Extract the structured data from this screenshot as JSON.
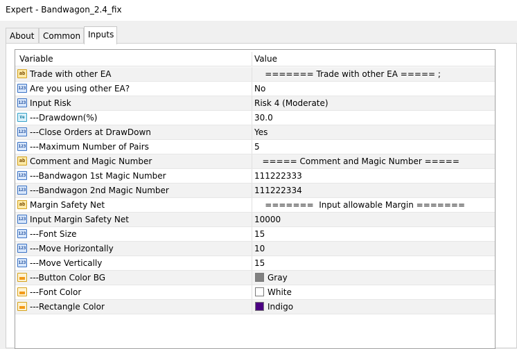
{
  "window": {
    "title": "Expert - Bandwagon_2.4_fix"
  },
  "tabs": [
    {
      "label": "About"
    },
    {
      "label": "Common"
    },
    {
      "label": "Inputs",
      "active": true
    }
  ],
  "table": {
    "headers": {
      "variable": "Variable",
      "value": "Value"
    },
    "rows": [
      {
        "icon": "ab-string-icon",
        "variable": "Trade with other EA",
        "value": "    ======= Trade with other EA ===== ;"
      },
      {
        "icon": "123-integer-icon",
        "variable": "Are you using other EA?",
        "value": "No"
      },
      {
        "icon": "123-integer-icon",
        "variable": "Input Risk",
        "value": "Risk 4 (Moderate)"
      },
      {
        "icon": "ve-double-icon",
        "variable": "---Drawdown(%)",
        "value": "30.0"
      },
      {
        "icon": "123-integer-icon",
        "variable": "---Close Orders at DrawDown",
        "value": "Yes"
      },
      {
        "icon": "123-integer-icon",
        "variable": "---Maximum Number of Pairs",
        "value": "5"
      },
      {
        "icon": "ab-string-icon",
        "variable": "Comment and Magic Number",
        "value": "   ===== Comment and Magic Number ====="
      },
      {
        "icon": "123-integer-icon",
        "variable": "---Bandwagon 1st Magic Number",
        "value": "111222333"
      },
      {
        "icon": "123-integer-icon",
        "variable": "---Bandwagon 2nd Magic Number",
        "value": "111222334"
      },
      {
        "icon": "ab-string-icon",
        "variable": "Margin Safety Net",
        "value": "    =======  Input allowable Margin ======="
      },
      {
        "icon": "123-integer-icon",
        "variable": "Input Margin Safety Net",
        "value": "10000"
      },
      {
        "icon": "123-integer-icon",
        "variable": "---Font Size",
        "value": "15"
      },
      {
        "icon": "123-integer-icon",
        "variable": "---Move Horizontally",
        "value": "10"
      },
      {
        "icon": "123-integer-icon",
        "variable": "---Move Vertically",
        "value": "15"
      },
      {
        "icon": "color-icon",
        "variable": "---Button Color BG",
        "value": "Gray",
        "swatch": "#808080"
      },
      {
        "icon": "color-icon",
        "variable": "---Font Color",
        "value": "White",
        "swatch": "#ffffff"
      },
      {
        "icon": "color-icon",
        "variable": "---Rectangle Color",
        "value": "Indigo",
        "swatch": "#4b0082"
      }
    ]
  },
  "colors": {
    "row_shade": "#f2f2f2",
    "grid_border": "#a0a0a0"
  }
}
